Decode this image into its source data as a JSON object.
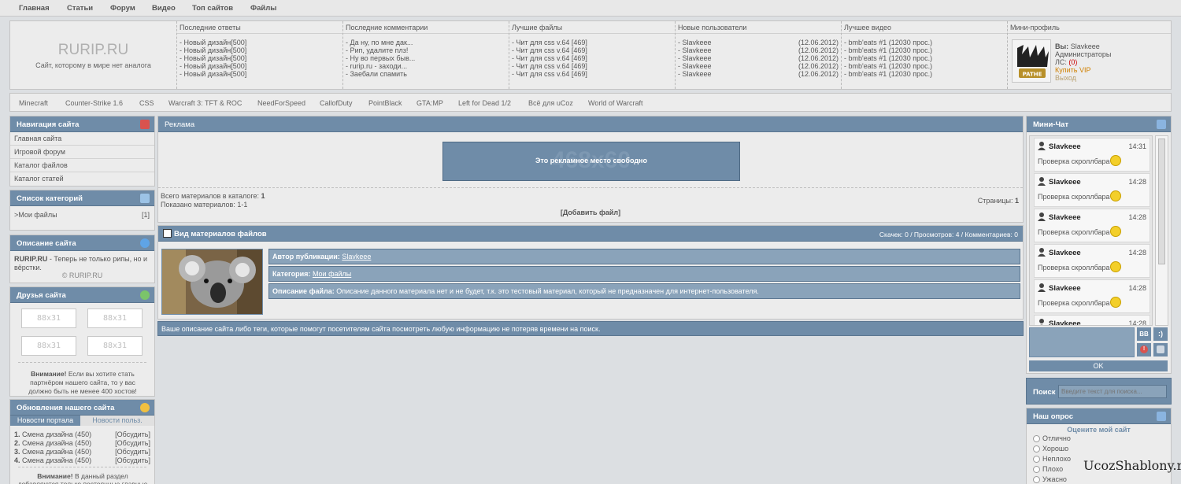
{
  "topnav": [
    "Главная",
    "Статьи",
    "Форум",
    "Видео",
    "Топ сайтов",
    "Файлы"
  ],
  "logo": {
    "title": "RURIP.RU",
    "slogan": "Сайт, которому в мире нет аналога"
  },
  "header_cols": [
    {
      "title": "Последние ответы",
      "items": [
        "- Новый дизайн[500]",
        "- Новый дизайн[500]",
        "- Новый дизайн[500]",
        "- Новый дизайн[500]",
        "- Новый дизайн[500]"
      ]
    },
    {
      "title": "Последние комментарии",
      "items": [
        "- Да ну, по мне дак...",
        "- Рип, удалите плз!",
        "- Ну во первых быв...",
        "- rurip.ru - заходи...",
        "- Заебали спамить"
      ]
    },
    {
      "title": "Лучшие файлы",
      "items": [
        "- Чит для css v.64 [469]",
        "- Чит для css v.64 [469]",
        "- Чит для css v.64 [469]",
        "- Чит для css v.64 [469]",
        "- Чит для css v.64 [469]"
      ]
    },
    {
      "title": "Новые пользователи",
      "items": [
        "- Slavkeee",
        "- Slavkeee",
        "- Slavkeee",
        "- Slavkeee",
        "- Slavkeee"
      ],
      "dates": [
        "(12.06.2012)",
        "(12.06.2012)",
        "(12.06.2012)",
        "(12.06.2012)",
        "(12.06.2012)"
      ]
    },
    {
      "title": "Лучшее видео",
      "items": [
        "- bmb'eats #1 (12030 прос.)",
        "- bmb'eats #1 (12030 прос.)",
        "- bmb'eats #1 (12030 прос.)",
        "- bmb'eats #1 (12030 прос.)",
        "- bmb'eats #1 (12030 прос.)"
      ]
    }
  ],
  "miniprofile": {
    "title": "Мини-профиль",
    "you_label": "Вы:",
    "user": "Slavkeee",
    "role": "Администраторы",
    "ls_label": "ЛС:",
    "ls_count": "(0)",
    "vip": "Купить VIP",
    "logout": "Выход"
  },
  "categories_bar": [
    "Minecraft",
    "Counter-Strike 1.6",
    "CSS",
    "Warcraft 3: TFT & ROC",
    "NeedForSpeed",
    "CallofDuty",
    "PointBlack",
    "GTA:MP",
    "Left for Dead 1/2",
    "Всё для uCoz",
    "World of Warcraft"
  ],
  "left": {
    "nav_title": "Навигация сайта",
    "nav_items": [
      "Главная сайта",
      "Игровой форум",
      "Каталог файлов",
      "Каталог статей"
    ],
    "catlist_title": "Список категорий",
    "catlist_item": "Мои файлы",
    "catlist_count": "[1]",
    "desc_title": "Описание сайта",
    "desc_bold": "RURIP.RU",
    "desc_text": " - Теперь не только рипы, но и вёрстки.",
    "desc_copy": "© RURIP.RU",
    "friends_title": "Друзья сайта",
    "friends_btn": "88x31",
    "friends_note_bold": "Внимание!",
    "friends_note": " Если вы хотите стать партнёром нашего сайта, то у вас должно быть не менее 400 хостов!",
    "updates_title": "Обновления нашего сайта",
    "updates_tabs": [
      "Новости портала",
      "Новости польз."
    ],
    "updates_items": [
      {
        "n": "1.",
        "t": "Смена дизайна (450)",
        "a": "[Обсудить]"
      },
      {
        "n": "2.",
        "t": "Смена дизайна (450)",
        "a": "[Обсудить]"
      },
      {
        "n": "3.",
        "t": "Смена дизайна (450)",
        "a": "[Обсудить]"
      },
      {
        "n": "4.",
        "t": "Смена дизайна (450)",
        "a": "[Обсудить]"
      }
    ],
    "updates_note_bold": "Внимание!",
    "updates_note": " В данный раздел добавляются только постоянные главные с нашего"
  },
  "center": {
    "ad_title": "Реклама",
    "ad_size": "468x60",
    "ad_text": "Это рекламное место свободно",
    "total_label": "Всего материалов в каталоге:",
    "total_value": "1",
    "shown_label": "Показано материалов:",
    "shown_value": "1-1",
    "pages_label": "Страницы:",
    "pages_value": "1",
    "add_file": "[Добавить файл]",
    "view_title": "Вид материалов файлов",
    "view_stats": "Скачек: 0 / Просмотров: 4 / Комментариев: 0",
    "author_label": "Автор публикации:",
    "author_value": "Slavkeee",
    "category_label": "Категория:",
    "category_value": "Мои файлы",
    "desc_label": "Описание файла:",
    "desc_value": "Описание данного материала нет и не будет, т.к. это тестовый материал, который не предназначен для интернет-пользователя.",
    "bottom_text": "Ваше описание сайта либо теги, которые помогут посетителям сайта посмотреть любую информацию не потеряв времени на поиск."
  },
  "right": {
    "chat_title": "Мини-Чат",
    "chat": [
      {
        "user": "Slavkeee",
        "time": "14:31",
        "text": "Проверка скроллбара"
      },
      {
        "user": "Slavkeee",
        "time": "14:28",
        "text": "Проверка скроллбара"
      },
      {
        "user": "Slavkeee",
        "time": "14:28",
        "text": "Проверка скроллбара"
      },
      {
        "user": "Slavkeee",
        "time": "14:28",
        "text": "Проверка скроллбара"
      },
      {
        "user": "Slavkeee",
        "time": "14:28",
        "text": "Проверка скроллбара"
      },
      {
        "user": "Slavkeee",
        "time": "14:28",
        "text": ""
      }
    ],
    "bb": "BB",
    "smile_btn": ":)",
    "ok": "OK",
    "search_label": "Поиск",
    "search_placeholder": "Введите текст для поиска...",
    "poll_title": "Наш опрос",
    "poll_question": "Оцените мой сайт",
    "poll_options": [
      "Отлично",
      "Хорошо",
      "Неплохо",
      "Плохо",
      "Ужасно"
    ]
  },
  "watermark": "UcozShablony.ru",
  "colors": {
    "accent": "#6f8ca8",
    "accent_dark": "#5b7690",
    "background": "#dcdfe2",
    "panel": "#ececec",
    "vip": "#d08000",
    "ls_count": "#cc0000"
  }
}
